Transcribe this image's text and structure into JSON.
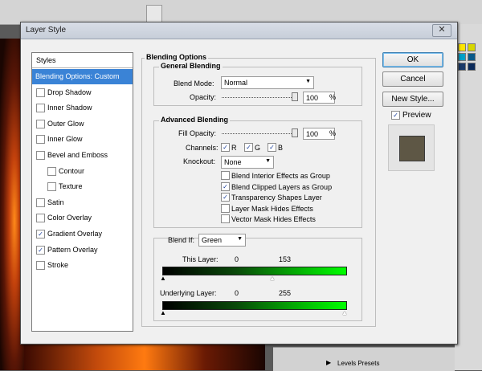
{
  "dialog": {
    "title": "Layer Style",
    "close_glyph": "✕"
  },
  "styles": {
    "header": "Styles",
    "items": [
      {
        "label": "Blending Options: Custom",
        "checkbox": false,
        "checked": false,
        "selected": true
      },
      {
        "label": "Drop Shadow",
        "checkbox": true,
        "checked": false
      },
      {
        "label": "Inner Shadow",
        "checkbox": true,
        "checked": false
      },
      {
        "label": "Outer Glow",
        "checkbox": true,
        "checked": false
      },
      {
        "label": "Inner Glow",
        "checkbox": true,
        "checked": false
      },
      {
        "label": "Bevel and Emboss",
        "checkbox": true,
        "checked": false
      },
      {
        "label": "Contour",
        "checkbox": true,
        "checked": false
      },
      {
        "label": "Texture",
        "checkbox": true,
        "checked": false
      },
      {
        "label": "Satin",
        "checkbox": true,
        "checked": false
      },
      {
        "label": "Color Overlay",
        "checkbox": true,
        "checked": false
      },
      {
        "label": "Gradient Overlay",
        "checkbox": true,
        "checked": true
      },
      {
        "label": "Pattern Overlay",
        "checkbox": true,
        "checked": true
      },
      {
        "label": "Stroke",
        "checkbox": true,
        "checked": false
      }
    ]
  },
  "blending": {
    "section_title": "Blending Options",
    "general_title": "General Blending",
    "blend_mode_label": "Blend Mode:",
    "blend_mode_value": "Normal",
    "opacity_label": "Opacity:",
    "opacity_value": "100",
    "percent": "%",
    "advanced_title": "Advanced Blending",
    "fill_opacity_label": "Fill Opacity:",
    "fill_opacity_value": "100",
    "channels_label": "Channels:",
    "channel_r": "R",
    "channel_g": "G",
    "channel_b": "B",
    "knockout_label": "Knockout:",
    "knockout_value": "None",
    "options": [
      {
        "label": "Blend Interior Effects as Group",
        "checked": false
      },
      {
        "label": "Blend Clipped Layers as Group",
        "checked": true
      },
      {
        "label": "Transparency Shapes Layer",
        "checked": true
      },
      {
        "label": "Layer Mask Hides Effects",
        "checked": false
      },
      {
        "label": "Vector Mask Hides Effects",
        "checked": false
      }
    ],
    "blend_if_label": "Blend If:",
    "blend_if_value": "Green",
    "this_layer_label": "This Layer:",
    "this_layer_low": "0",
    "this_layer_high": "153",
    "underlying_label": "Underlying Layer:",
    "underlying_low": "0",
    "underlying_high": "255"
  },
  "buttons": {
    "ok": "OK",
    "cancel": "Cancel",
    "new_style": "New Style...",
    "preview": "Preview"
  },
  "background": {
    "levels_presets": "Levels Presets"
  },
  "colors": {
    "selection": "#3a83d6",
    "ramp_start": "#000000",
    "ramp_end": "#00ff00"
  }
}
